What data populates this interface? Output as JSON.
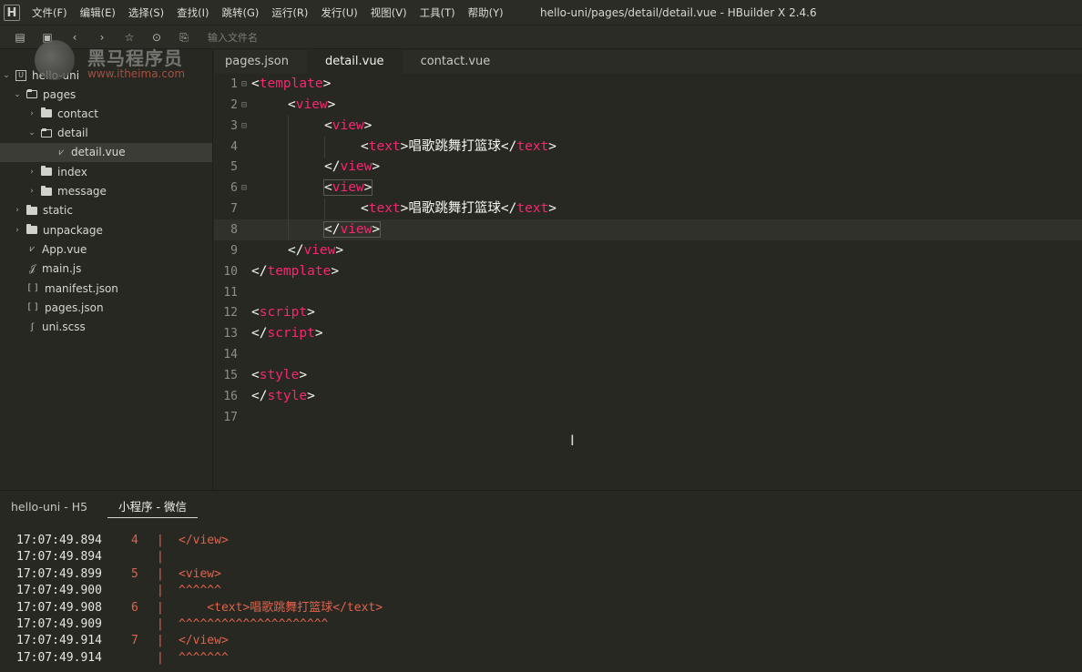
{
  "menubar": {
    "logo": "H",
    "items": [
      "文件(F)",
      "编辑(E)",
      "选择(S)",
      "查找(I)",
      "跳转(G)",
      "运行(R)",
      "发行(U)",
      "视图(V)",
      "工具(T)",
      "帮助(Y)"
    ],
    "title": "hello-uni/pages/detail/detail.vue - HBuilder X 2.4.6"
  },
  "toolbar": {
    "icons": [
      "save-all-icon",
      "save-icon",
      "back-icon",
      "forward-icon",
      "star-icon",
      "run-icon",
      "preview-icon"
    ],
    "search_placeholder": "输入文件名"
  },
  "watermark": {
    "text_cn": "黑马程序员",
    "url": "www.itheima.com"
  },
  "sidebar": {
    "project": "hello-uni",
    "tree": [
      {
        "label": "pages",
        "type": "folder",
        "open": true,
        "depth": 1
      },
      {
        "label": "contact",
        "type": "folder",
        "open": false,
        "depth": 2
      },
      {
        "label": "detail",
        "type": "folder",
        "open": true,
        "depth": 2
      },
      {
        "label": "detail.vue",
        "type": "vue",
        "depth": 3,
        "selected": true
      },
      {
        "label": "index",
        "type": "folder",
        "open": false,
        "depth": 2
      },
      {
        "label": "message",
        "type": "folder",
        "open": false,
        "depth": 2
      },
      {
        "label": "static",
        "type": "folder",
        "open": false,
        "depth": 1
      },
      {
        "label": "unpackage",
        "type": "folder",
        "open": false,
        "depth": 1
      },
      {
        "label": "App.vue",
        "type": "vue",
        "depth": 1
      },
      {
        "label": "main.js",
        "type": "js",
        "depth": 1
      },
      {
        "label": "manifest.json",
        "type": "json",
        "depth": 1
      },
      {
        "label": "pages.json",
        "type": "json",
        "depth": 1
      },
      {
        "label": "uni.scss",
        "type": "scss",
        "depth": 1
      }
    ]
  },
  "tabs": [
    {
      "label": "pages.json",
      "active": false
    },
    {
      "label": "detail.vue",
      "active": true
    },
    {
      "label": "contact.vue",
      "active": false
    }
  ],
  "editor": {
    "lines": [
      {
        "n": "1",
        "fold": "⊟",
        "indent": 0,
        "parts": [
          [
            "p",
            "<"
          ],
          [
            "t",
            "template"
          ],
          [
            "p",
            ">"
          ]
        ]
      },
      {
        "n": "2",
        "fold": "⊟",
        "indent": 1,
        "parts": [
          [
            "p",
            "<"
          ],
          [
            "t",
            "view"
          ],
          [
            "p",
            ">"
          ]
        ]
      },
      {
        "n": "3",
        "fold": "⊟",
        "indent": 2,
        "parts": [
          [
            "p",
            "<"
          ],
          [
            "t",
            "view"
          ],
          [
            "p",
            ">"
          ]
        ]
      },
      {
        "n": "4",
        "fold": "",
        "indent": 3,
        "parts": [
          [
            "p",
            "<"
          ],
          [
            "t",
            "text"
          ],
          [
            "p",
            ">"
          ],
          [
            "x",
            "唱歌跳舞打篮球"
          ],
          [
            "p",
            "</"
          ],
          [
            "t",
            "text"
          ],
          [
            "p",
            ">"
          ]
        ]
      },
      {
        "n": "5",
        "fold": "",
        "indent": 2,
        "parts": [
          [
            "p",
            "</"
          ],
          [
            "t",
            "view"
          ],
          [
            "p",
            ">"
          ]
        ]
      },
      {
        "n": "6",
        "fold": "⊟",
        "indent": 2,
        "parts": [
          [
            "p",
            "<"
          ],
          [
            "t",
            "view"
          ],
          [
            "p",
            ">"
          ]
        ],
        "boxed": true
      },
      {
        "n": "7",
        "fold": "",
        "indent": 3,
        "parts": [
          [
            "p",
            "<"
          ],
          [
            "t",
            "text"
          ],
          [
            "p",
            ">"
          ],
          [
            "x",
            "唱歌跳舞打篮球"
          ],
          [
            "p",
            "</"
          ],
          [
            "t",
            "text"
          ],
          [
            "p",
            ">"
          ]
        ]
      },
      {
        "n": "8",
        "fold": "",
        "indent": 2,
        "parts": [
          [
            "p",
            "</"
          ],
          [
            "t",
            "view"
          ],
          [
            "p",
            ">"
          ]
        ],
        "boxed": true,
        "current": true
      },
      {
        "n": "9",
        "fold": "",
        "indent": 1,
        "parts": [
          [
            "p",
            "</"
          ],
          [
            "t",
            "view"
          ],
          [
            "p",
            ">"
          ]
        ]
      },
      {
        "n": "10",
        "fold": "",
        "indent": 0,
        "parts": [
          [
            "p",
            "</"
          ],
          [
            "t",
            "template"
          ],
          [
            "p",
            ">"
          ]
        ]
      },
      {
        "n": "11",
        "fold": "",
        "indent": 0,
        "parts": []
      },
      {
        "n": "12",
        "fold": "",
        "indent": 0,
        "parts": [
          [
            "p",
            "<"
          ],
          [
            "t",
            "script"
          ],
          [
            "p",
            ">"
          ]
        ]
      },
      {
        "n": "13",
        "fold": "",
        "indent": 0,
        "parts": [
          [
            "p",
            "</"
          ],
          [
            "t",
            "script"
          ],
          [
            "p",
            ">"
          ]
        ]
      },
      {
        "n": "14",
        "fold": "",
        "indent": 0,
        "parts": []
      },
      {
        "n": "15",
        "fold": "",
        "indent": 0,
        "parts": [
          [
            "p",
            "<"
          ],
          [
            "t",
            "style"
          ],
          [
            "p",
            ">"
          ]
        ]
      },
      {
        "n": "16",
        "fold": "",
        "indent": 0,
        "parts": [
          [
            "p",
            "</"
          ],
          [
            "t",
            "style"
          ],
          [
            "p",
            ">"
          ]
        ]
      },
      {
        "n": "17",
        "fold": "",
        "indent": 0,
        "parts": []
      }
    ]
  },
  "console": {
    "tabs": [
      {
        "label": "hello-uni - H5",
        "active": false
      },
      {
        "label": "小程序 - 微信",
        "active": true
      }
    ],
    "rows": [
      {
        "time": "17:07:49.894",
        "num": "4",
        "bar": "|",
        "code": "</view>"
      },
      {
        "time": "17:07:49.894",
        "num": "",
        "bar": "|",
        "code": ""
      },
      {
        "time": "17:07:49.899",
        "num": "5",
        "bar": "|",
        "code": "<view>"
      },
      {
        "time": "17:07:49.900",
        "num": "",
        "bar": "|",
        "code": "^^^^^^"
      },
      {
        "time": "17:07:49.908",
        "num": "6",
        "bar": "|",
        "code": "    <text>唱歌跳舞打篮球</text>"
      },
      {
        "time": "17:07:49.909",
        "num": "",
        "bar": "|",
        "code": "^^^^^^^^^^^^^^^^^^^^^"
      },
      {
        "time": "17:07:49.914",
        "num": "7",
        "bar": "|",
        "code": "</view>"
      },
      {
        "time": "17:07:49.914",
        "num": "",
        "bar": "|",
        "code": "^^^^^^^"
      }
    ]
  },
  "colors": {
    "background": "#272822",
    "tag": "#f92672",
    "error": "#e0624c"
  }
}
